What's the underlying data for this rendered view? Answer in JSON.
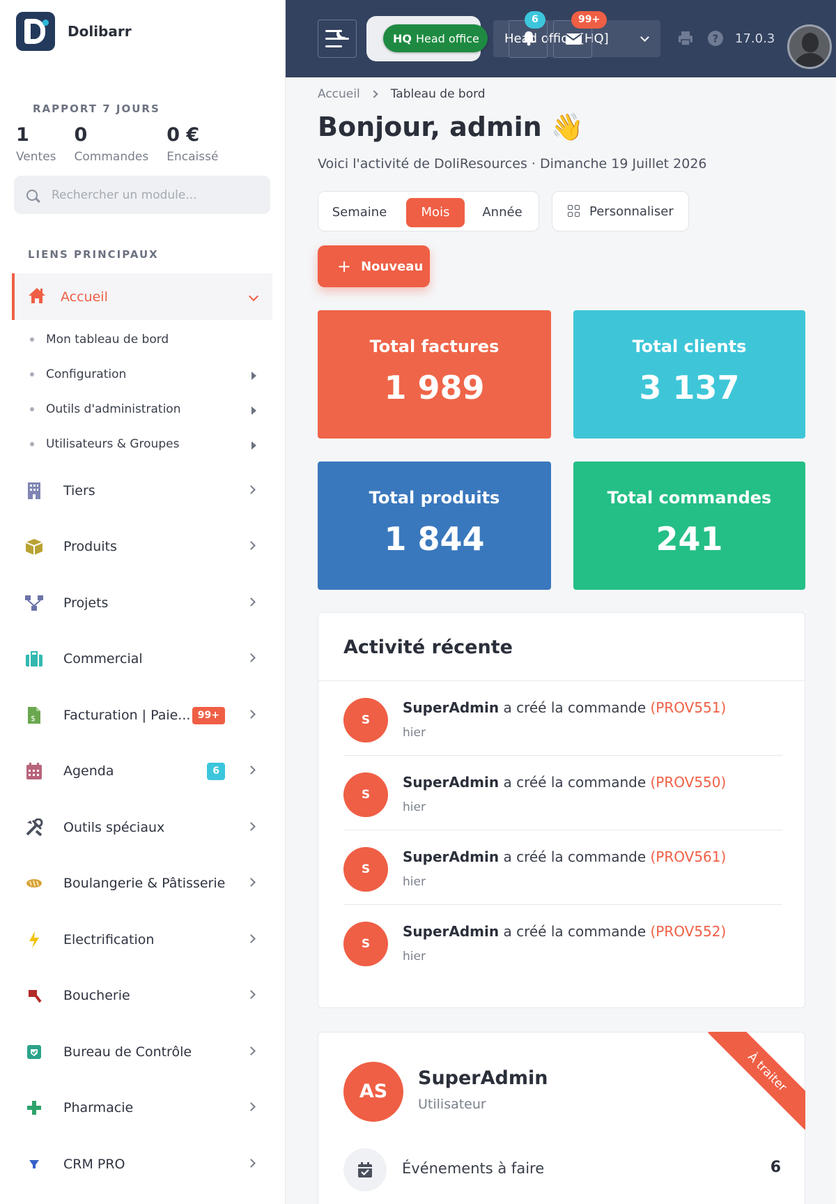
{
  "brand": {
    "name": "Dolibarr"
  },
  "report": {
    "title": "RAPPORT 7 JOURS",
    "stats": [
      {
        "value": "1",
        "label": "Ventes"
      },
      {
        "value": "0",
        "label": "Commandes"
      },
      {
        "value": "0 €",
        "label": "Encaissé"
      }
    ]
  },
  "search": {
    "placeholder": "Rechercher un module..."
  },
  "links_title": "LIENS PRINCIPAUX",
  "nav_active": {
    "label": "Accueil",
    "icon": "home-icon"
  },
  "subitems": [
    {
      "label": "Mon tableau de bord"
    },
    {
      "label": "Configuration"
    },
    {
      "label": "Outils d'administration"
    },
    {
      "label": "Utilisateurs & Groupes"
    }
  ],
  "nav": [
    {
      "label": "Tiers",
      "icon": "building-icon",
      "color": "#7f86b3"
    },
    {
      "label": "Produits",
      "icon": "box-icon",
      "color": "#b9a234"
    },
    {
      "label": "Projets",
      "icon": "sitemap-icon",
      "color": "#6b73a8"
    },
    {
      "label": "Commercial",
      "icon": "briefcase-icon",
      "color": "#33b8b0"
    },
    {
      "label": "Facturation | Paie...",
      "icon": "invoice-icon",
      "color": "#6aa84f",
      "badge": "99+"
    },
    {
      "label": "Agenda",
      "icon": "calendar-icon",
      "color": "#b8647b",
      "badge": "6"
    },
    {
      "label": "Outils spéciaux",
      "icon": "tools-icon",
      "color": "#4a4f5c"
    },
    {
      "label": "Boulangerie & Pâtisserie",
      "icon": "bread-icon",
      "color": "#d9a33a"
    },
    {
      "label": "Electrification",
      "icon": "bolt-icon",
      "color": "#f2c200"
    },
    {
      "label": "Boucherie",
      "icon": "cleaver-icon",
      "color": "#b22b2b"
    },
    {
      "label": "Bureau de Contrôle",
      "icon": "shield-check-icon",
      "color": "#2ba38a"
    },
    {
      "label": "Pharmacie",
      "icon": "plus-icon",
      "color": "#2ea36b"
    },
    {
      "label": "CRM PRO",
      "icon": "filter-icon",
      "color": "#3563c9"
    }
  ],
  "header": {
    "hq_short": "HQ",
    "hq_label": "Head office",
    "entity_select": "Head office [HQ]",
    "notif_count": "6",
    "msg_count": "99+",
    "version": "17.0.3"
  },
  "breadcrumb": {
    "home": "Accueil",
    "current": "Tableau de bord"
  },
  "greeting": "Bonjour, admin 👋",
  "subtitle": "Voici l'activité de DoliResources · Dimanche 19 Juillet 2026",
  "period": {
    "options": [
      "Semaine",
      "Mois",
      "Année"
    ],
    "selected": "Mois"
  },
  "customize_label": "Personnaliser",
  "new_label": "Nouveau",
  "cards": [
    {
      "title": "Total factures",
      "value": "1 989",
      "color": "#ef6549"
    },
    {
      "title": "Total clients",
      "value": "3 137",
      "color": "#3ec6d8"
    },
    {
      "title": "Total produits",
      "value": "1 844",
      "color": "#3a78bd"
    },
    {
      "title": "Total commandes",
      "value": "241",
      "color": "#24bf86"
    }
  ],
  "activity": {
    "title": "Activité récente",
    "items": [
      {
        "initial": "S",
        "user": "SuperAdmin",
        "action": " a créé la commande ",
        "ref": "(PROV551)",
        "time": "hier"
      },
      {
        "initial": "S",
        "user": "SuperAdmin",
        "action": " a créé la commande ",
        "ref": "(PROV550)",
        "time": "hier"
      },
      {
        "initial": "S",
        "user": "SuperAdmin",
        "action": " a créé la commande ",
        "ref": "(PROV561)",
        "time": "hier"
      },
      {
        "initial": "S",
        "user": "SuperAdmin",
        "action": " a créé la commande ",
        "ref": "(PROV552)",
        "time": "hier"
      }
    ]
  },
  "user_card": {
    "initials": "AS",
    "name": "SuperAdmin",
    "role": "Utilisateur",
    "ribbon": "À traiter",
    "todo_label": "Événements à faire",
    "todo_count": "6"
  }
}
